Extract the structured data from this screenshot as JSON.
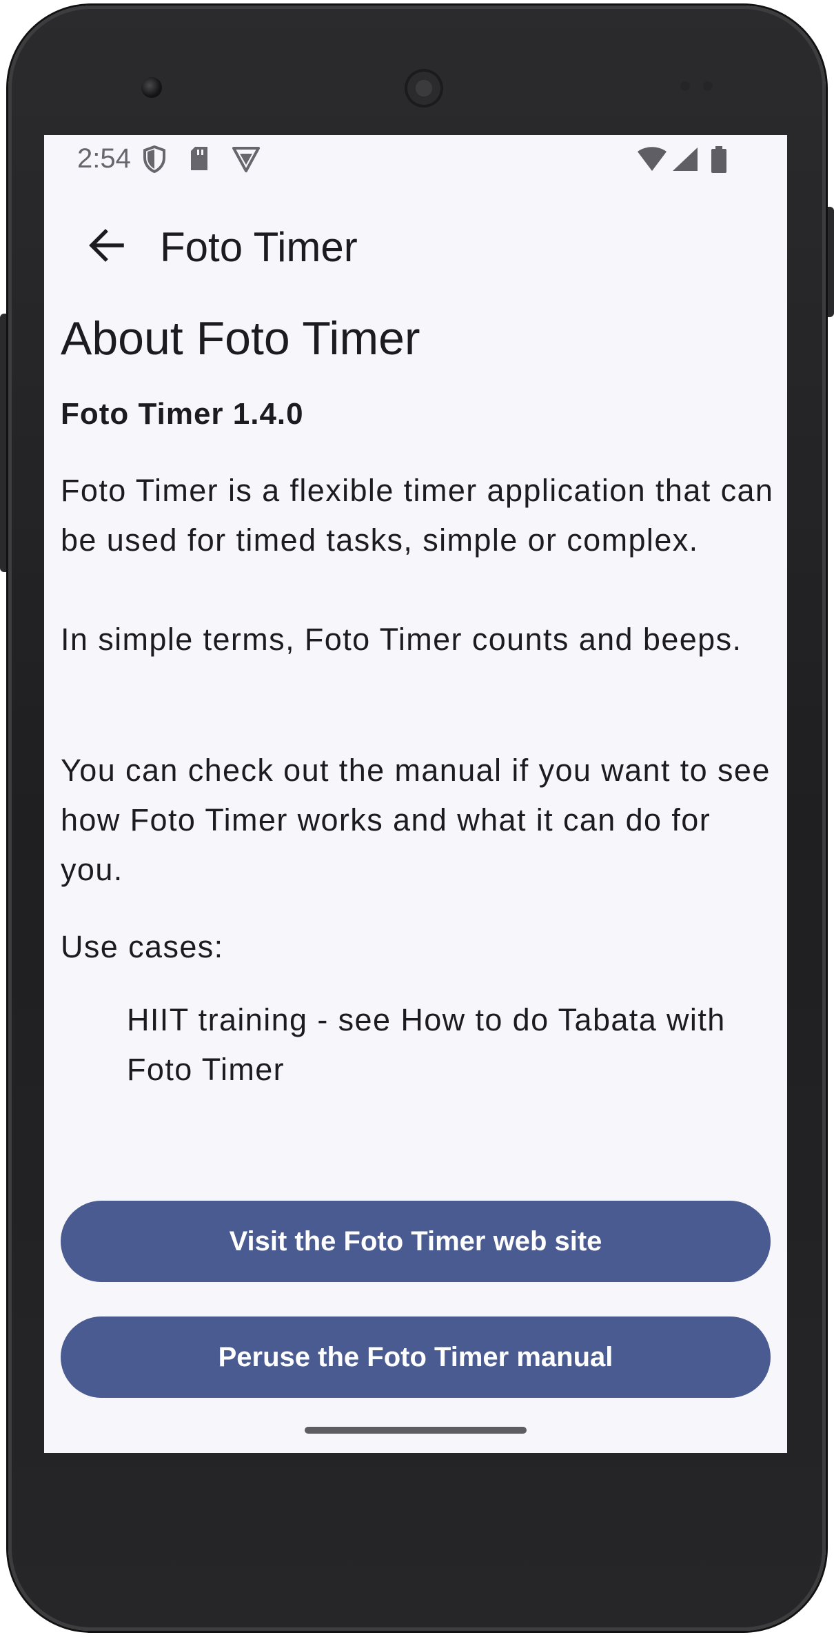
{
  "status_bar": {
    "time": "2:54",
    "left_icons": [
      "shield-icon",
      "sd-card-icon",
      "vpn-icon"
    ],
    "right_icons": [
      "wifi-icon",
      "signal-icon",
      "battery-icon"
    ]
  },
  "app_bar": {
    "title": "Foto Timer",
    "back_icon": "arrow-back-icon"
  },
  "about": {
    "heading": "About Foto Timer",
    "version": "Foto Timer 1.4.0",
    "paragraph_1": "Foto Timer is a flexible timer application that can be used for timed tasks, simple or complex.",
    "paragraph_2": "In simple terms, Foto Timer counts and beeps.",
    "paragraph_3": "You can check out the manual if you want to see how Foto Timer works and what it can do for you.",
    "use_cases_label": "Use cases:",
    "use_cases": [
      "HIIT training - see How to do Tabata with Foto Timer"
    ]
  },
  "buttons": {
    "website": "Visit the Foto Timer web site",
    "manual": "Peruse the Foto Timer manual"
  },
  "colors": {
    "screen_background": "#f7f6fb",
    "button": "#4a5b91",
    "text": "#1c1b1f",
    "phone_frame": "#242426"
  }
}
